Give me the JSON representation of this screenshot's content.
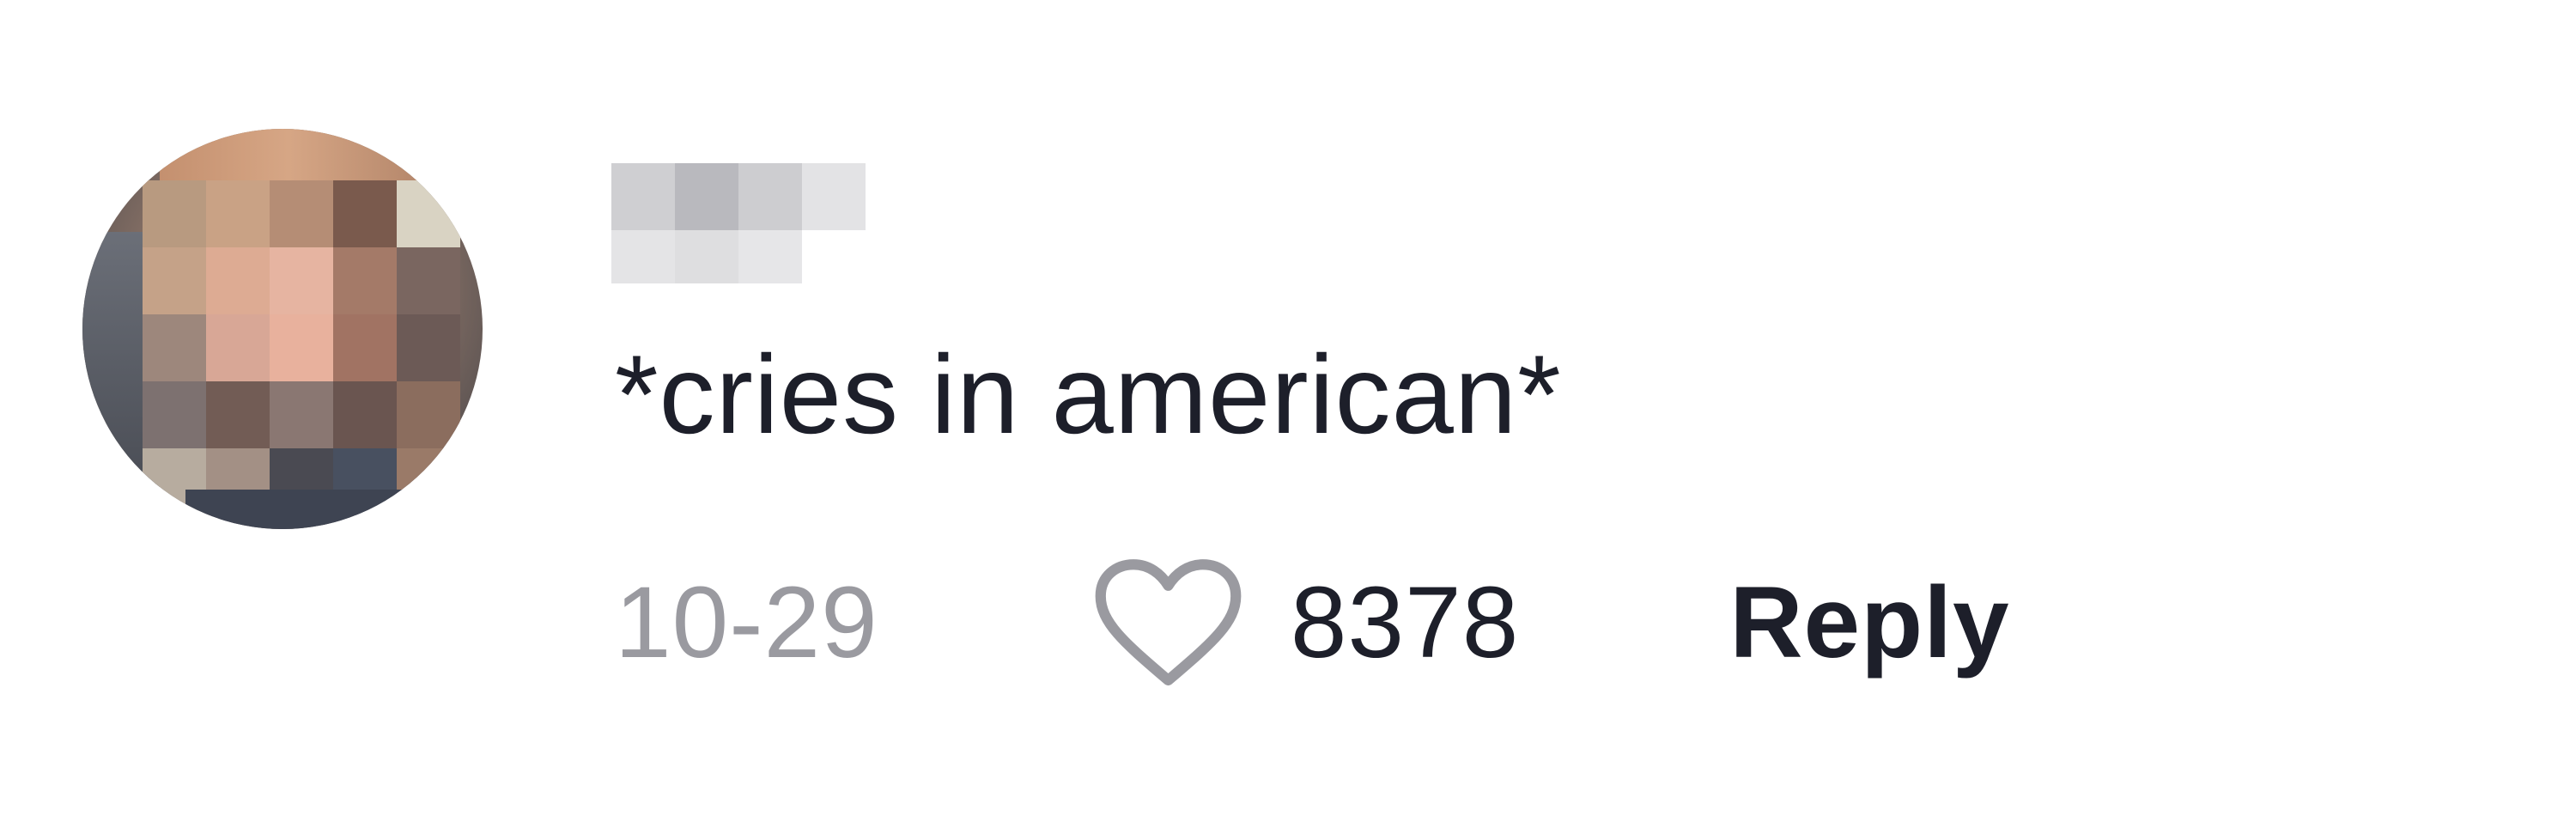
{
  "comment": {
    "text": "*cries in american*",
    "date": "10-29",
    "like_count": "8378",
    "reply_label": "Reply"
  },
  "icons": {
    "like": "heart-outline-icon"
  },
  "colors": {
    "text_primary": "#1d1f2a",
    "text_secondary": "#9a9aa0",
    "icon_stroke": "#9a9aa0",
    "background": "#ffffff"
  }
}
